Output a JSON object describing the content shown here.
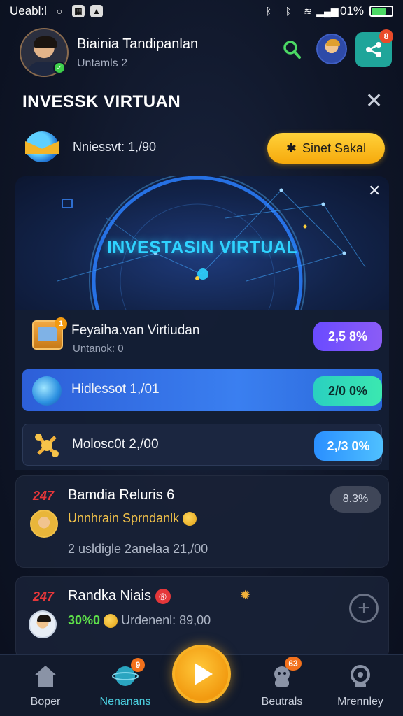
{
  "status_bar": {
    "carrier": "Ueabl:l",
    "battery_text": "01%",
    "icons": [
      "circle-icon",
      "gallery-icon",
      "image-icon",
      "bluetooth-icon",
      "bluetooth-icon",
      "wifi-icon",
      "signal-icon",
      "battery-icon"
    ]
  },
  "header": {
    "user_name": "Biainia Tandipanlan",
    "user_sub": "Untamls 2",
    "share_badge": "8"
  },
  "section": {
    "title": "INVESSK VIRTUAN"
  },
  "invest_row": {
    "text": "Nniessvt: 1,/90",
    "sell_label": "Sinet Sakal",
    "sell_icon": "✱"
  },
  "banner": {
    "title": "INVESTASIN VIRTUAL"
  },
  "list": [
    {
      "title": "Feyaiha.van Virtiudan",
      "sub": "Untanok: 0",
      "value": "2,5 8%",
      "badge": "1"
    },
    {
      "title": "Hidlessot 1,/01",
      "value": "2/0 0%"
    },
    {
      "title": "Molosc0t 2,/00",
      "value": "2,/3 0%"
    }
  ],
  "cards": [
    {
      "tag": "247",
      "title": "Bamdia Reluris 6",
      "line1": "Unnhrain Sprndanlk",
      "line2": "2 usldigle 2anelaa 21,/00",
      "pill": "8.3%"
    },
    {
      "tag": "247",
      "title": "Randka Niais",
      "title_icon": "®",
      "line1_green": "30%0",
      "line1_rest": "Urdenenl: 89,00"
    }
  ],
  "nav": {
    "items": [
      {
        "label": "Boper"
      },
      {
        "label": "Nenanans",
        "badge": "9"
      },
      {
        "label": "Beutrals",
        "badge": "63"
      },
      {
        "label": "Mrennley"
      }
    ]
  },
  "colors": {
    "accent_yellow": "#f6a90c",
    "accent_cyan": "#2fd3ff",
    "accent_green": "#4cd964",
    "accent_red": "#e5373a",
    "bg": "#0f1628"
  }
}
